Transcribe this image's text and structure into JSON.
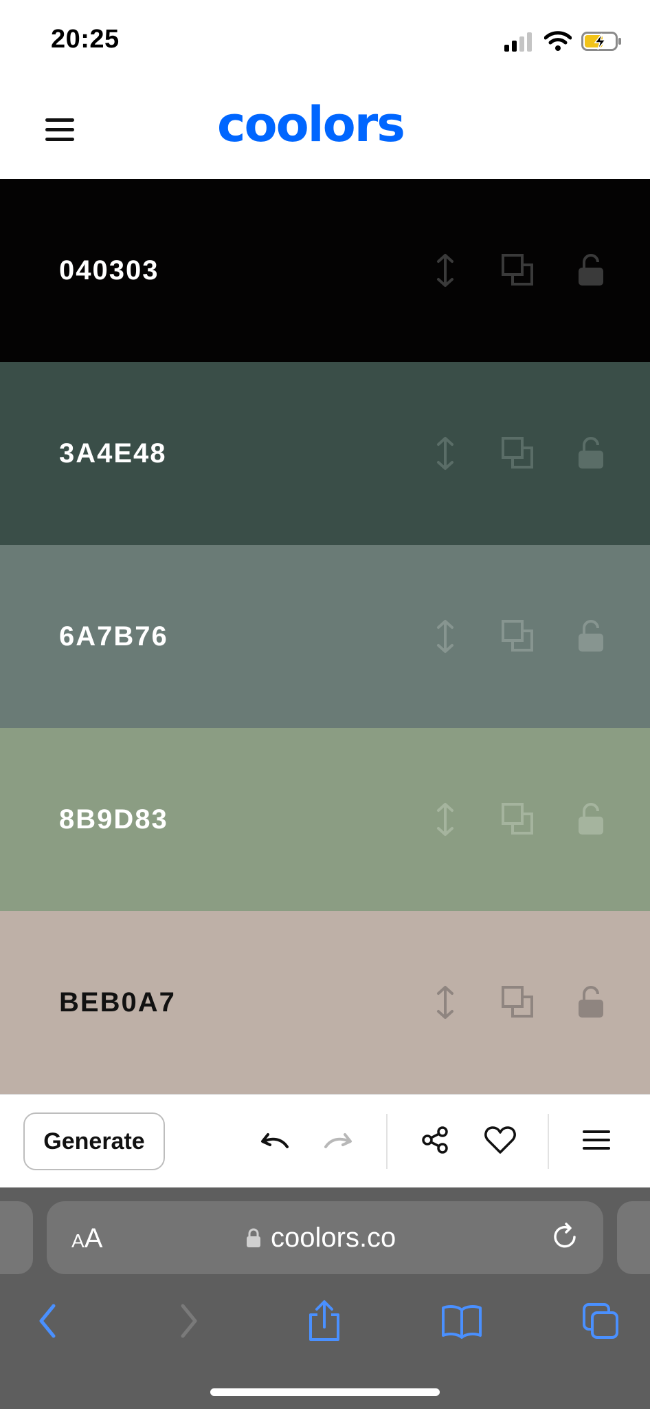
{
  "status_bar": {
    "time": "20:25"
  },
  "header": {
    "logo": "coolors"
  },
  "palette": [
    {
      "hex": "040303",
      "bg": "#040303",
      "text_color": "#ffffff",
      "icon_color": "#3a3a3a"
    },
    {
      "hex": "3A4E48",
      "bg": "#3A4E48",
      "text_color": "#ffffff",
      "icon_color": "#5a6d67"
    },
    {
      "hex": "6A7B76",
      "bg": "#6A7B76",
      "text_color": "#ffffff",
      "icon_color": "#879590"
    },
    {
      "hex": "8B9D83",
      "bg": "#8B9D83",
      "text_color": "#ffffff",
      "icon_color": "#a5b49e"
    },
    {
      "hex": "BEB0A7",
      "bg": "#BEB0A7",
      "text_color": "#111111",
      "icon_color": "#8f8580"
    }
  ],
  "toolbar": {
    "generate_label": "Generate"
  },
  "browser": {
    "text_size_small": "A",
    "text_size_large": "A",
    "url": "coolors.co"
  },
  "colors": {
    "brand": "#0066ff",
    "safari_blue": "#4a90ff"
  },
  "icons": [
    "hamburger-icon",
    "drag-icon",
    "copy-icon",
    "unlock-icon",
    "undo-icon",
    "redo-icon",
    "share-icon",
    "heart-icon",
    "menu-icon",
    "lock-icon",
    "reload-icon",
    "back-icon",
    "forward-icon",
    "share-sheet-icon",
    "bookmarks-icon",
    "tabs-icon"
  ]
}
